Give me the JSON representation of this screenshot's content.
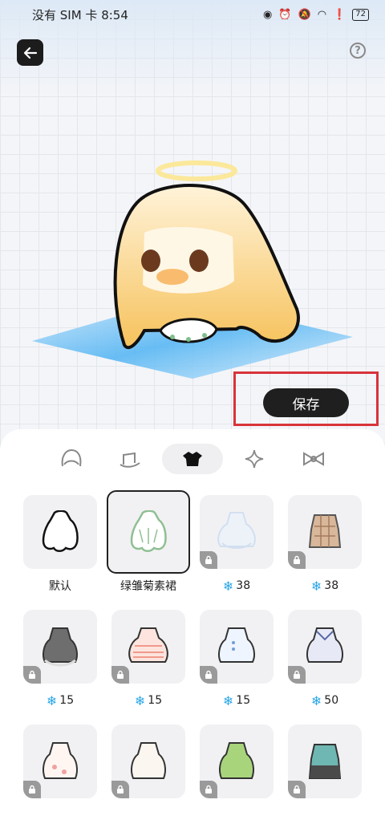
{
  "status_bar": {
    "carrier_time": "没有 SIM 卡 8:54",
    "battery": "72"
  },
  "save_label": "保存",
  "tabs": [
    {
      "icon": "hair-icon",
      "active": false
    },
    {
      "icon": "hat-icon",
      "active": false
    },
    {
      "icon": "clothes-icon",
      "active": true
    },
    {
      "icon": "sparkle-icon",
      "active": false
    },
    {
      "icon": "bow-icon",
      "active": false
    }
  ],
  "items": [
    {
      "label": "默认",
      "price": "",
      "locked": false,
      "selected": false
    },
    {
      "label": "绿雏菊素裙",
      "price": "",
      "locked": false,
      "selected": true
    },
    {
      "label": "",
      "price": "38",
      "locked": true,
      "selected": false
    },
    {
      "label": "",
      "price": "38",
      "locked": true,
      "selected": false
    },
    {
      "label": "",
      "price": "15",
      "locked": true,
      "selected": false
    },
    {
      "label": "",
      "price": "15",
      "locked": true,
      "selected": false
    },
    {
      "label": "",
      "price": "15",
      "locked": true,
      "selected": false
    },
    {
      "label": "",
      "price": "50",
      "locked": true,
      "selected": false
    },
    {
      "label": "",
      "price": "",
      "locked": true,
      "selected": false
    },
    {
      "label": "",
      "price": "",
      "locked": true,
      "selected": false
    },
    {
      "label": "",
      "price": "",
      "locked": true,
      "selected": false
    },
    {
      "label": "",
      "price": "",
      "locked": true,
      "selected": false
    }
  ],
  "colors": {
    "accent": "#1f1f1f",
    "highlight": "#d8333a",
    "currency": "#2aa6e6"
  }
}
